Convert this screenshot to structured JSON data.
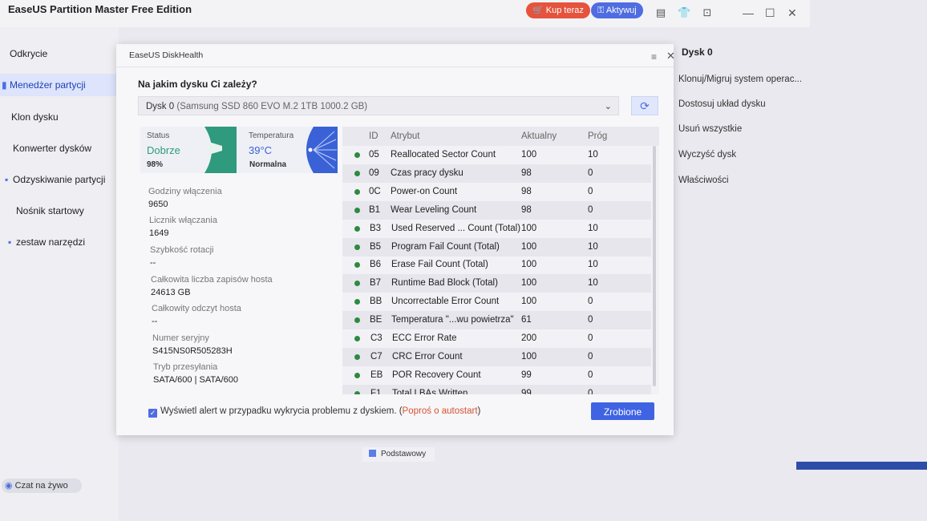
{
  "app": {
    "title": "EaseUS Partition Master Free Edition",
    "buy_label": "Kup teraz",
    "activate_label": "Aktywuj",
    "toolbar_icons": [
      "document-icon",
      "shirt-icon",
      "download-icon"
    ]
  },
  "sidebar": {
    "items": [
      {
        "label": "Odkrycie",
        "icon": "compass-icon"
      },
      {
        "label": "Menedżer partycji",
        "icon": "partition-icon",
        "active": true
      },
      {
        "label": "Klon dysku",
        "icon": "clone-icon"
      },
      {
        "label": "Konwerter dysków",
        "icon": "convert-icon"
      },
      {
        "label": "Odzyskiwanie partycji",
        "icon": "recover-icon"
      },
      {
        "label": "Nośnik startowy",
        "icon": "usb-icon"
      },
      {
        "label": "zestaw narzędzi",
        "icon": "toolbox-icon"
      }
    ],
    "chat_label": "Czat na żywo"
  },
  "right_panel": {
    "title": "Dysk 0",
    "items": [
      "Klonuj/Migruj system operac...",
      "Dostosuj układ dysku",
      "Usuń wszystkie",
      "Wyczyść dysk",
      "Właściwości"
    ]
  },
  "legend": {
    "label": "Podstawowy",
    "color": "#5b7de6"
  },
  "dialog": {
    "title": "EaseUS DiskHealth",
    "question": "Na jakim dysku Ci zależy?",
    "disk_name": "Dysk 0",
    "disk_detail": "(Samsung SSD 860 EVO M.2 1TB 1000.2 GB)",
    "status": {
      "status_label": "Status",
      "status_value": "Dobrze",
      "status_pct": "98%",
      "temp_label": "Temperatura",
      "temp_value": "39°C",
      "temp_status": "Normalna"
    },
    "info": [
      {
        "label": "Godziny włączenia",
        "value": "9650"
      },
      {
        "label": "Licznik włączania",
        "value": "1649"
      },
      {
        "label": "Szybkość rotacji",
        "value": "--"
      },
      {
        "label": "Całkowita liczba zapisów hosta",
        "value": "24613 GB"
      },
      {
        "label": "Całkowity odczyt hosta",
        "value": "--"
      },
      {
        "label": "Numer seryjny",
        "value": "S415NS0R505283H"
      },
      {
        "label": "Tryb przesyłania",
        "value": "SATA/600 | SATA/600"
      }
    ],
    "table": {
      "headers": [
        "ID",
        "Atrybut",
        "Aktualny",
        "Próg"
      ],
      "rows": [
        {
          "id": "05",
          "attr": "Reallocated Sector Count",
          "current": "100",
          "threshold": "10"
        },
        {
          "id": "09",
          "attr": "Czas pracy dysku",
          "current": "98",
          "threshold": "0"
        },
        {
          "id": "0C",
          "attr": "Power-on Count",
          "current": "98",
          "threshold": "0"
        },
        {
          "id": "B1",
          "attr": "Wear Leveling Count",
          "current": "98",
          "threshold": "0"
        },
        {
          "id": "B3",
          "attr": "Used Reserved ... Count (Total)",
          "current": "100",
          "threshold": "10"
        },
        {
          "id": "B5",
          "attr": "Program Fail Count (Total)",
          "current": "100",
          "threshold": "10"
        },
        {
          "id": "B6",
          "attr": "Erase Fail Count (Total)",
          "current": "100",
          "threshold": "10"
        },
        {
          "id": "B7",
          "attr": "Runtime Bad Block (Total)",
          "current": "100",
          "threshold": "10"
        },
        {
          "id": "BB",
          "attr": "Uncorrectable Error Count",
          "current": "100",
          "threshold": "0"
        },
        {
          "id": "BE",
          "attr": "Temperatura \"...wu powietrza\"",
          "current": "61",
          "threshold": "0"
        },
        {
          "id": "C3",
          "attr": "ECC Error Rate",
          "current": "200",
          "threshold": "0"
        },
        {
          "id": "C7",
          "attr": "CRC Error Count",
          "current": "100",
          "threshold": "0"
        },
        {
          "id": "EB",
          "attr": "POR Recovery Count",
          "current": "99",
          "threshold": "0"
        },
        {
          "id": "F1",
          "attr": "Total LBAs Written",
          "current": "99",
          "threshold": "0"
        }
      ]
    },
    "alert_text": "Wyświetl alert w przypadku wykrycia problemu z dyskiem. (",
    "alert_link": "Poproś o autostart",
    "alert_close": ")",
    "done_label": "Zrobione",
    "status_color": "#2f9a7d",
    "temp_color": "#3a62d6",
    "ok_dot_color": "#2e8a3e"
  }
}
